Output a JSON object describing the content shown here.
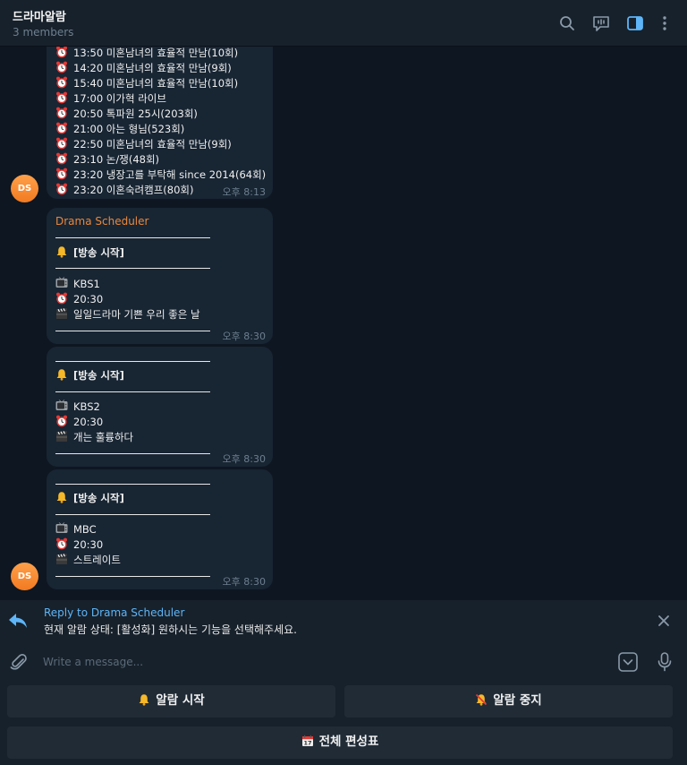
{
  "header": {
    "title": "드라마알람",
    "members": "3 members"
  },
  "messages": {
    "schedule_lines": [
      "13:50 미혼남녀의 효율적 만남(10회)",
      "14:20 미혼남녀의 효율적 만남(9회)",
      "15:40 미혼남녀의 효율적 만남(10회)",
      "17:00 이가혁 라이브",
      "20:50 톡파원 25시(203회)",
      "21:00 아는 형님(523회)",
      "22:50 미혼남녀의 효율적 만남(9회)",
      "23:10 논/쟁(48회)",
      "23:20 냉장고를 부탁해 since 2014(64회)",
      "23:20 이혼숙려캠프(80회)"
    ],
    "schedule_time": "오후 8:13",
    "avatar_initials": "DS",
    "sender": "Drama Scheduler",
    "start_label": "[방송 시작]",
    "notifications": [
      {
        "channel": "KBS1",
        "time": "20:30",
        "program": "일일드라마 기쁜 우리 좋은 날",
        "sent": "오후 8:30"
      },
      {
        "channel": "KBS2",
        "time": "20:30",
        "program": "개는 훌륭하다",
        "sent": "오후 8:30"
      },
      {
        "channel": "MBC",
        "time": "20:30",
        "program": "스트레이트",
        "sent": "오후 8:30"
      }
    ]
  },
  "reply": {
    "to": "Reply to Drama Scheduler",
    "text": "현재 알람 상태: [활성화] 원하시는 기능을 선택해주세요."
  },
  "composer": {
    "placeholder": "Write a message..."
  },
  "keyboard": {
    "start_alarm": "알람 시작",
    "stop_alarm": "알람 중지",
    "full_schedule": "전체 편성표"
  },
  "colors": {
    "accent": "#5eb5f7",
    "sender": "#e8883c",
    "bubble": "#182533",
    "background": "#0e1621"
  }
}
